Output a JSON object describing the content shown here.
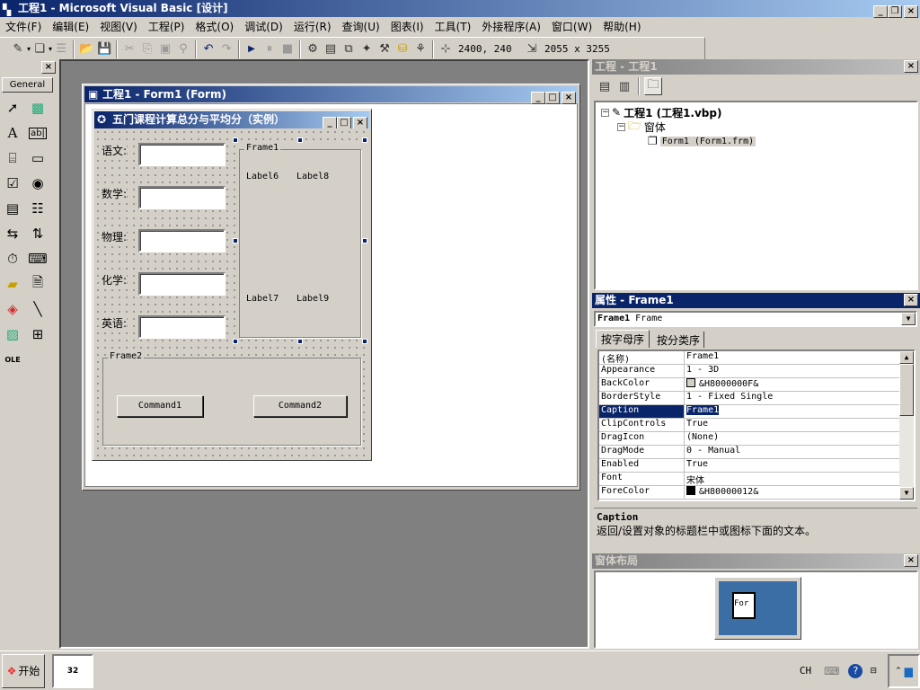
{
  "app": {
    "title": "工程1 - Microsoft Visual Basic [设计]"
  },
  "menu": [
    "文件(F)",
    "编辑(E)",
    "视图(V)",
    "工程(P)",
    "格式(O)",
    "调试(D)",
    "运行(R)",
    "查询(U)",
    "图表(I)",
    "工具(T)",
    "外接程序(A)",
    "窗口(W)",
    "帮助(H)"
  ],
  "toolbar": {
    "position": "2400, 240",
    "size": "2055 x 3255"
  },
  "toolbox": {
    "tab": "General"
  },
  "designer": {
    "title": "工程1 - Form1 (Form)"
  },
  "form": {
    "title": "五门课程计算总分与平均分（实例）",
    "labels": [
      "语文:",
      "数学:",
      "物理:",
      "化学:",
      "英语:"
    ],
    "frame1": "Frame1",
    "frame2": "Frame2",
    "label6": "Label6",
    "label8": "Label8",
    "label7": "Label7",
    "label9": "Label9",
    "command1": "Command1",
    "command2": "Command2"
  },
  "project": {
    "title": "工程 - 工程1",
    "root": "工程1 (工程1.vbp)",
    "folder": "窗体",
    "item": "Form1 (Form1.frm)"
  },
  "properties": {
    "title": "属性 - Frame1",
    "object_bold": "Frame1",
    "object_type": "Frame",
    "tabs": [
      "按字母序",
      "按分类序"
    ],
    "rows": [
      [
        "(名称)",
        "Frame1"
      ],
      [
        "Appearance",
        "1 - 3D"
      ],
      [
        "BackColor",
        "&H8000000F&"
      ],
      [
        "BorderStyle",
        "1 - Fixed Single"
      ],
      [
        "Caption",
        "Frame1"
      ],
      [
        "ClipControls",
        "True"
      ],
      [
        "DragIcon",
        "(None)"
      ],
      [
        "DragMode",
        "0 - Manual"
      ],
      [
        "Enabled",
        "True"
      ],
      [
        "Font",
        "宋体"
      ],
      [
        "ForeColor",
        "&H80000012&"
      ]
    ],
    "desc_title": "Caption",
    "desc_text": "返回/设置对象的标题栏中或图标下面的文本。"
  },
  "layout": {
    "title": "窗体布局",
    "form_label": "For"
  },
  "taskbar": {
    "start": "开始",
    "lang": "CH"
  }
}
